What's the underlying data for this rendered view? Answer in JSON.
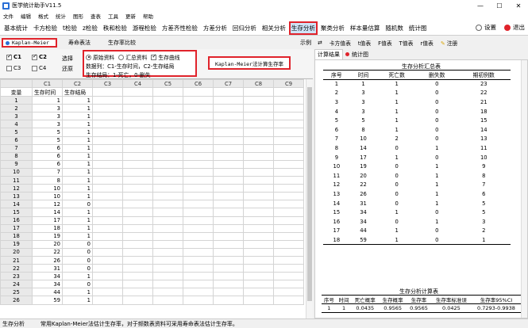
{
  "window": {
    "title": "医学统计助手V11.5"
  },
  "menu": [
    "文件",
    "编辑",
    "格式",
    "统计",
    "图形",
    "查表",
    "工具",
    "更新",
    "帮助"
  ],
  "toolbar": {
    "items": [
      "基本统计",
      "卡方检验",
      "t检验",
      "z检验",
      "秩和检验",
      "游程检验",
      "方差齐性检验",
      "方差分析",
      "回归分析",
      "相关分析",
      "生存分析",
      "聚类分析",
      "样本量估算",
      "随机数",
      "统计图"
    ],
    "active": "生存分析",
    "settings": "设置",
    "exit": "退出"
  },
  "subtabs": {
    "km": "Kaplan-Meier",
    "lifetable": "寿命表法",
    "compare": "生存率比较",
    "example": "示例"
  },
  "options": {
    "c1": "C1",
    "c2": "C2",
    "c3": "C3",
    "c4": "C4",
    "select": "选择",
    "restore": "还原",
    "raw": "原始资料",
    "summary": "汇总资料",
    "curve": "生存曲线",
    "line2": "数据列：C1-生存时间，C2-生存结局",
    "line3": "生存结局：1-死亡，0-删失",
    "calc_button": "Kaplan-Meier法计算生存率"
  },
  "sheet": {
    "columns": [
      "C1",
      "C2",
      "C3",
      "C4",
      "C5",
      "C6",
      "C7",
      "C8",
      "C9"
    ],
    "header_row": {
      "label": "变量",
      "c1": "生存时间",
      "c2": "生存结局"
    },
    "rows": [
      [
        1,
        1,
        1
      ],
      [
        2,
        3,
        1
      ],
      [
        3,
        3,
        1
      ],
      [
        4,
        3,
        1
      ],
      [
        5,
        5,
        1
      ],
      [
        6,
        5,
        1
      ],
      [
        7,
        6,
        1
      ],
      [
        8,
        6,
        1
      ],
      [
        9,
        6,
        1
      ],
      [
        10,
        7,
        1
      ],
      [
        11,
        8,
        1
      ],
      [
        12,
        10,
        1
      ],
      [
        13,
        10,
        1
      ],
      [
        14,
        12,
        0
      ],
      [
        15,
        14,
        1
      ],
      [
        16,
        17,
        1
      ],
      [
        17,
        18,
        1
      ],
      [
        18,
        19,
        1
      ],
      [
        19,
        20,
        0
      ],
      [
        20,
        22,
        0
      ],
      [
        21,
        26,
        0
      ],
      [
        22,
        31,
        0
      ],
      [
        23,
        34,
        1
      ],
      [
        24,
        34,
        0
      ],
      [
        25,
        44,
        1
      ],
      [
        26,
        59,
        1
      ]
    ]
  },
  "right_tools": [
    "卡方值表",
    "t值表",
    "F值表",
    "T值表",
    "r值表",
    "注册"
  ],
  "right_tabs": {
    "results": "计算结果",
    "chart": "统计图"
  },
  "summary_table": {
    "title": "生存分析汇总表",
    "headers": [
      "序号",
      "时间",
      "死亡数",
      "删失数",
      "期初例数"
    ],
    "rows": [
      [
        1,
        1,
        1,
        0,
        23
      ],
      [
        2,
        3,
        1,
        0,
        22
      ],
      [
        3,
        3,
        1,
        0,
        21
      ],
      [
        4,
        3,
        1,
        0,
        18
      ],
      [
        5,
        5,
        1,
        0,
        15
      ],
      [
        6,
        8,
        1,
        0,
        14
      ],
      [
        7,
        10,
        2,
        0,
        13
      ],
      [
        8,
        14,
        0,
        1,
        11
      ],
      [
        9,
        17,
        1,
        0,
        10
      ],
      [
        10,
        19,
        0,
        1,
        9
      ],
      [
        11,
        20,
        0,
        1,
        8
      ],
      [
        12,
        22,
        0,
        1,
        7
      ],
      [
        13,
        26,
        0,
        1,
        6
      ],
      [
        14,
        31,
        0,
        1,
        5
      ],
      [
        15,
        34,
        1,
        0,
        5
      ],
      [
        16,
        34,
        0,
        1,
        3
      ],
      [
        17,
        44,
        1,
        0,
        2
      ],
      [
        18,
        59,
        1,
        0,
        1
      ]
    ]
  },
  "calc_table": {
    "title": "生存分析计算表",
    "headers": [
      "序号",
      "时间",
      "死亡概率",
      "生存概率",
      "生存率",
      "生存率标准误",
      "生存率95%CI"
    ],
    "rows": [
      [
        1,
        1,
        "0.0435",
        "0.9565",
        "0.9565",
        "0.0425",
        "0.7293-0.9938"
      ]
    ]
  },
  "status": {
    "left": "生存分析",
    "message": "常用Kaplan-Meier法估计生存率，对于频数表资料可采用寿命表法估计生存率。"
  }
}
